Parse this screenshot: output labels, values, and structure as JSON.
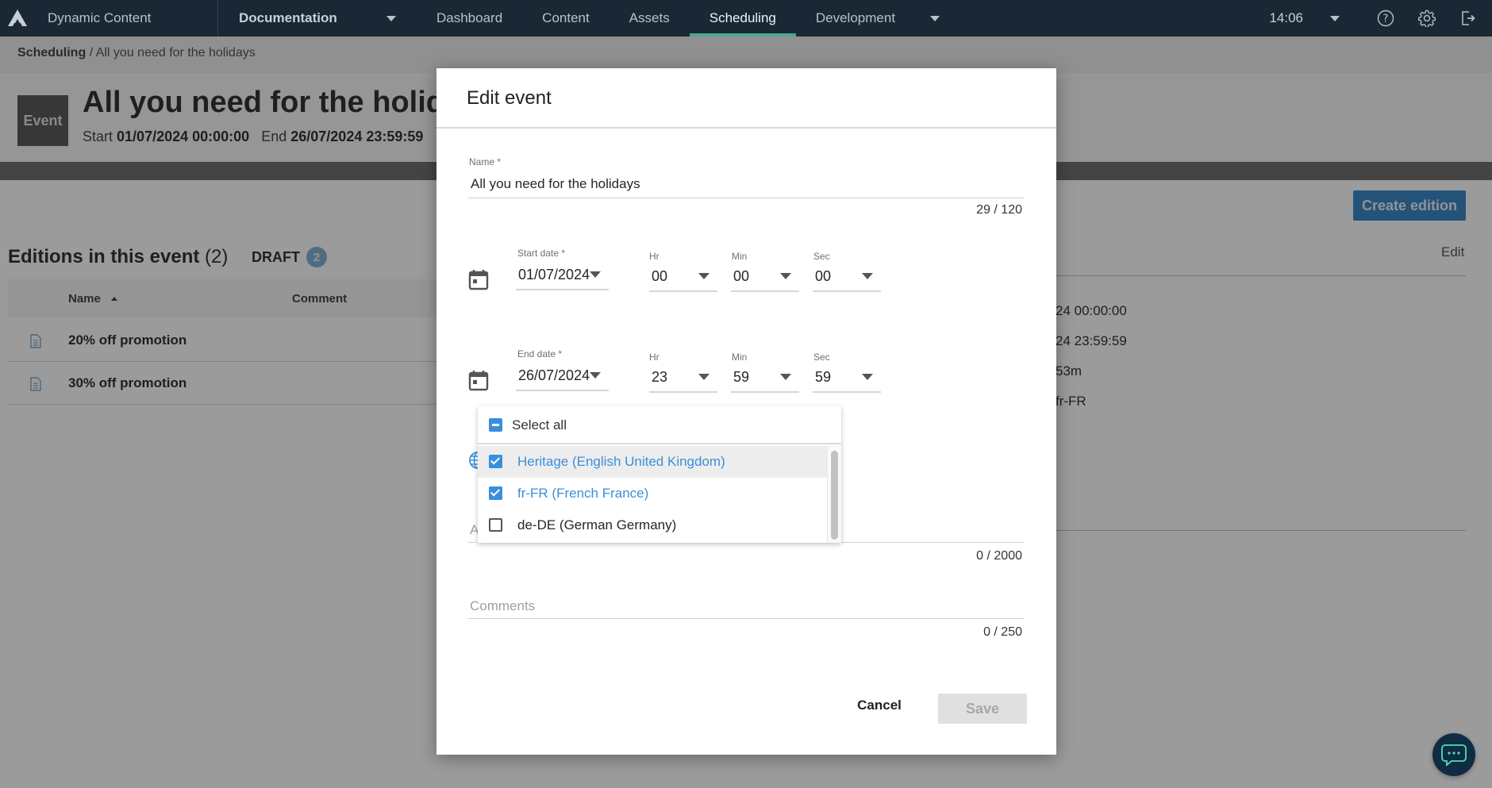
{
  "topnav": {
    "app_name": "Dynamic Content",
    "hub": "Documentation",
    "tabs": [
      {
        "label": "Dashboard",
        "active": false
      },
      {
        "label": "Content",
        "active": false
      },
      {
        "label": "Assets",
        "active": false
      },
      {
        "label": "Scheduling",
        "active": true
      },
      {
        "label": "Development",
        "active": false
      }
    ],
    "clock": "14:06",
    "icons": [
      "help-icon",
      "settings-icon",
      "logout-icon"
    ]
  },
  "breadcrumb": {
    "root": "Scheduling",
    "current": "/ All you need for the holidays"
  },
  "event": {
    "badge": "Event",
    "title": "All you need for the holidays",
    "start_label": "Start",
    "start_value": "01/07/2024 00:00:00",
    "end_label": "End",
    "end_value": "26/07/2024 23:59:59"
  },
  "editions": {
    "create_button": "Create edition",
    "title": "Editions in this event",
    "count": "(2)",
    "draft_label": "DRAFT",
    "draft_count": "2",
    "columns": {
      "name": "Name",
      "comment": "Comment"
    },
    "rows": [
      {
        "name": "20% off promotion"
      },
      {
        "name": "30% off promotion"
      }
    ]
  },
  "details_panel": {
    "edit_link": "Edit",
    "values": [
      "24 00:00:00",
      "24 23:59:59",
      "53m",
      "fr-FR"
    ]
  },
  "dialog": {
    "title": "Edit event",
    "name": {
      "label": "Name *",
      "value": "All you need for the holidays",
      "counter": "29 / 120"
    },
    "start": {
      "date_label": "Start date *",
      "date": "01/07/2024",
      "hr_label": "Hr",
      "hr": "00",
      "min_label": "Min",
      "min": "00",
      "sec_label": "Sec",
      "sec": "00"
    },
    "end": {
      "date_label": "End date *",
      "date": "26/07/2024",
      "hr_label": "Hr",
      "hr": "23",
      "min_label": "Min",
      "min": "59",
      "sec_label": "Sec",
      "sec": "59"
    },
    "locales": {
      "select_all": "Select all",
      "select_all_state": "indeterminate",
      "items": [
        {
          "label": "Heritage (English United Kingdom)",
          "checked": true
        },
        {
          "label": "fr-FR (French France)",
          "checked": true
        },
        {
          "label": "de-DE (German Germany)",
          "checked": false
        }
      ]
    },
    "brief": {
      "placeholder_partial": "A",
      "counter": "0 / 2000"
    },
    "comments": {
      "placeholder": "Comments",
      "counter": "0 / 250"
    },
    "cancel_button": "Cancel",
    "save_button": "Save"
  },
  "colors": {
    "nav_bg": "#1a2836",
    "active_tab_underline": "#4aa88a",
    "accent_blue": "#3a8fdc",
    "chat_button": "#0f2c44"
  }
}
